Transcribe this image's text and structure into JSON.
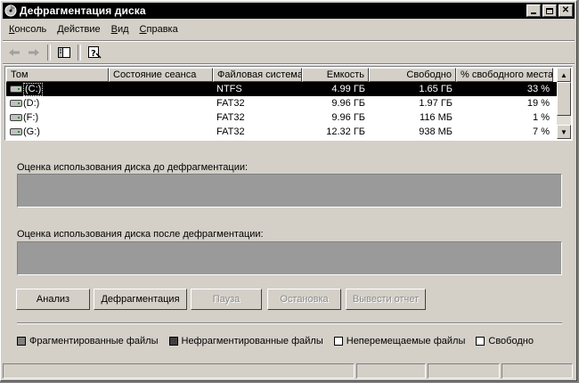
{
  "window": {
    "title": "Дефрагментация диска"
  },
  "menu": [
    {
      "label": "Консоль",
      "accel": "К"
    },
    {
      "label": "Действие",
      "accel": "Д"
    },
    {
      "label": "Вид",
      "accel": "В"
    },
    {
      "label": "Справка",
      "accel": "С"
    }
  ],
  "table": {
    "headers": [
      "Том",
      "Состояние сеанса",
      "Файловая система",
      "Емкость",
      "Свободно",
      "% свободного места"
    ],
    "rows": [
      {
        "volume": "(C:)",
        "status": "",
        "fs": "NTFS",
        "capacity": "4.99 ГБ",
        "free": "1.65 ГБ",
        "pct": "33 %"
      },
      {
        "volume": "(D:)",
        "status": "",
        "fs": "FAT32",
        "capacity": "9.96 ГБ",
        "free": "1.97 ГБ",
        "pct": "19 %"
      },
      {
        "volume": "(F:)",
        "status": "",
        "fs": "FAT32",
        "capacity": "9.96 ГБ",
        "free": "116 МБ",
        "pct": "1 %"
      },
      {
        "volume": "(G:)",
        "status": "",
        "fs": "FAT32",
        "capacity": "12.32 ГБ",
        "free": "938 МБ",
        "pct": "7 %"
      }
    ]
  },
  "before_label": "Оценка использования диска до дефрагментации:",
  "after_label": "Оценка использования диска после дефрагментации:",
  "buttons": {
    "analyze": "Анализ",
    "defrag": "Дефрагментация",
    "pause": "Пауза",
    "stop": "Остановка",
    "report": "Вывести отчет"
  },
  "legend": {
    "fragmented": "Фрагментированные файлы",
    "contiguous": "Нефрагментированные файлы",
    "unmovable": "Неперемещаемые файлы",
    "free": "Свободно"
  },
  "colors": {
    "fragmented": "#808080",
    "contiguous": "#404040",
    "unmovable": "#ffffff",
    "free": "#ffffff"
  }
}
